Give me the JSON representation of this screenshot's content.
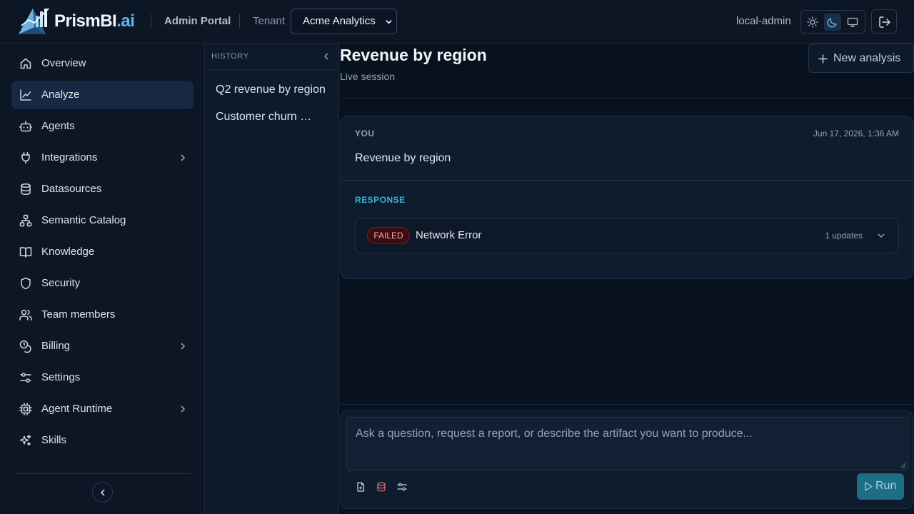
{
  "app": {
    "brand_main": "PrismBI",
    "brand_suffix": ".ai",
    "portal_label": "Admin Portal",
    "tenant_label": "Tenant",
    "tenant_value": "Acme Analytics",
    "user_name": "local-admin",
    "theme_options": [
      "light",
      "dark",
      "system"
    ],
    "theme_selected": "dark"
  },
  "sidebar": {
    "items": [
      {
        "label": "Overview",
        "icon": "home-icon"
      },
      {
        "label": "Analyze",
        "icon": "line-chart-icon",
        "active": true
      },
      {
        "label": "Agents",
        "icon": "bot-icon"
      },
      {
        "label": "Integrations",
        "icon": "plug-icon",
        "expandable": true
      },
      {
        "label": "Datasources",
        "icon": "database-icon"
      },
      {
        "label": "Semantic Catalog",
        "icon": "network-icon"
      },
      {
        "label": "Knowledge",
        "icon": "book-open-icon"
      },
      {
        "label": "Security",
        "icon": "shield-icon"
      },
      {
        "label": "Team members",
        "icon": "users-icon"
      },
      {
        "label": "Billing",
        "icon": "coins-icon",
        "expandable": true
      },
      {
        "label": "Settings",
        "icon": "sliders-icon"
      },
      {
        "label": "Agent Runtime",
        "icon": "cpu-icon",
        "expandable": true
      },
      {
        "label": "Skills",
        "icon": "sparkles-icon"
      }
    ]
  },
  "history": {
    "title": "HISTORY",
    "items": [
      {
        "label": "Q2 revenue by region"
      },
      {
        "label": "Customer churn analysis"
      }
    ]
  },
  "main": {
    "title": "Revenue by region",
    "subtitle": "Live session",
    "new_button_label": "New analysis",
    "conversation": {
      "author_label": "YOU",
      "timestamp": "Jun 17, 2026, 1:36 AM",
      "prompt": "Revenue by region",
      "response_label": "RESPONSE",
      "status_badge": "FAILED",
      "status_color": "#fca5a5",
      "result_message": "Network Error",
      "updates_label": "1 updates"
    },
    "composer": {
      "placeholder": "Ask a question, request a report, or describe the artifact you want to produce...",
      "run_label": "Run"
    }
  },
  "colors": {
    "accent": "#33b3d0",
    "brand_suffix": "#5fb8ec",
    "danger": "#7f1d1d",
    "run_button": "#1d6e85"
  }
}
